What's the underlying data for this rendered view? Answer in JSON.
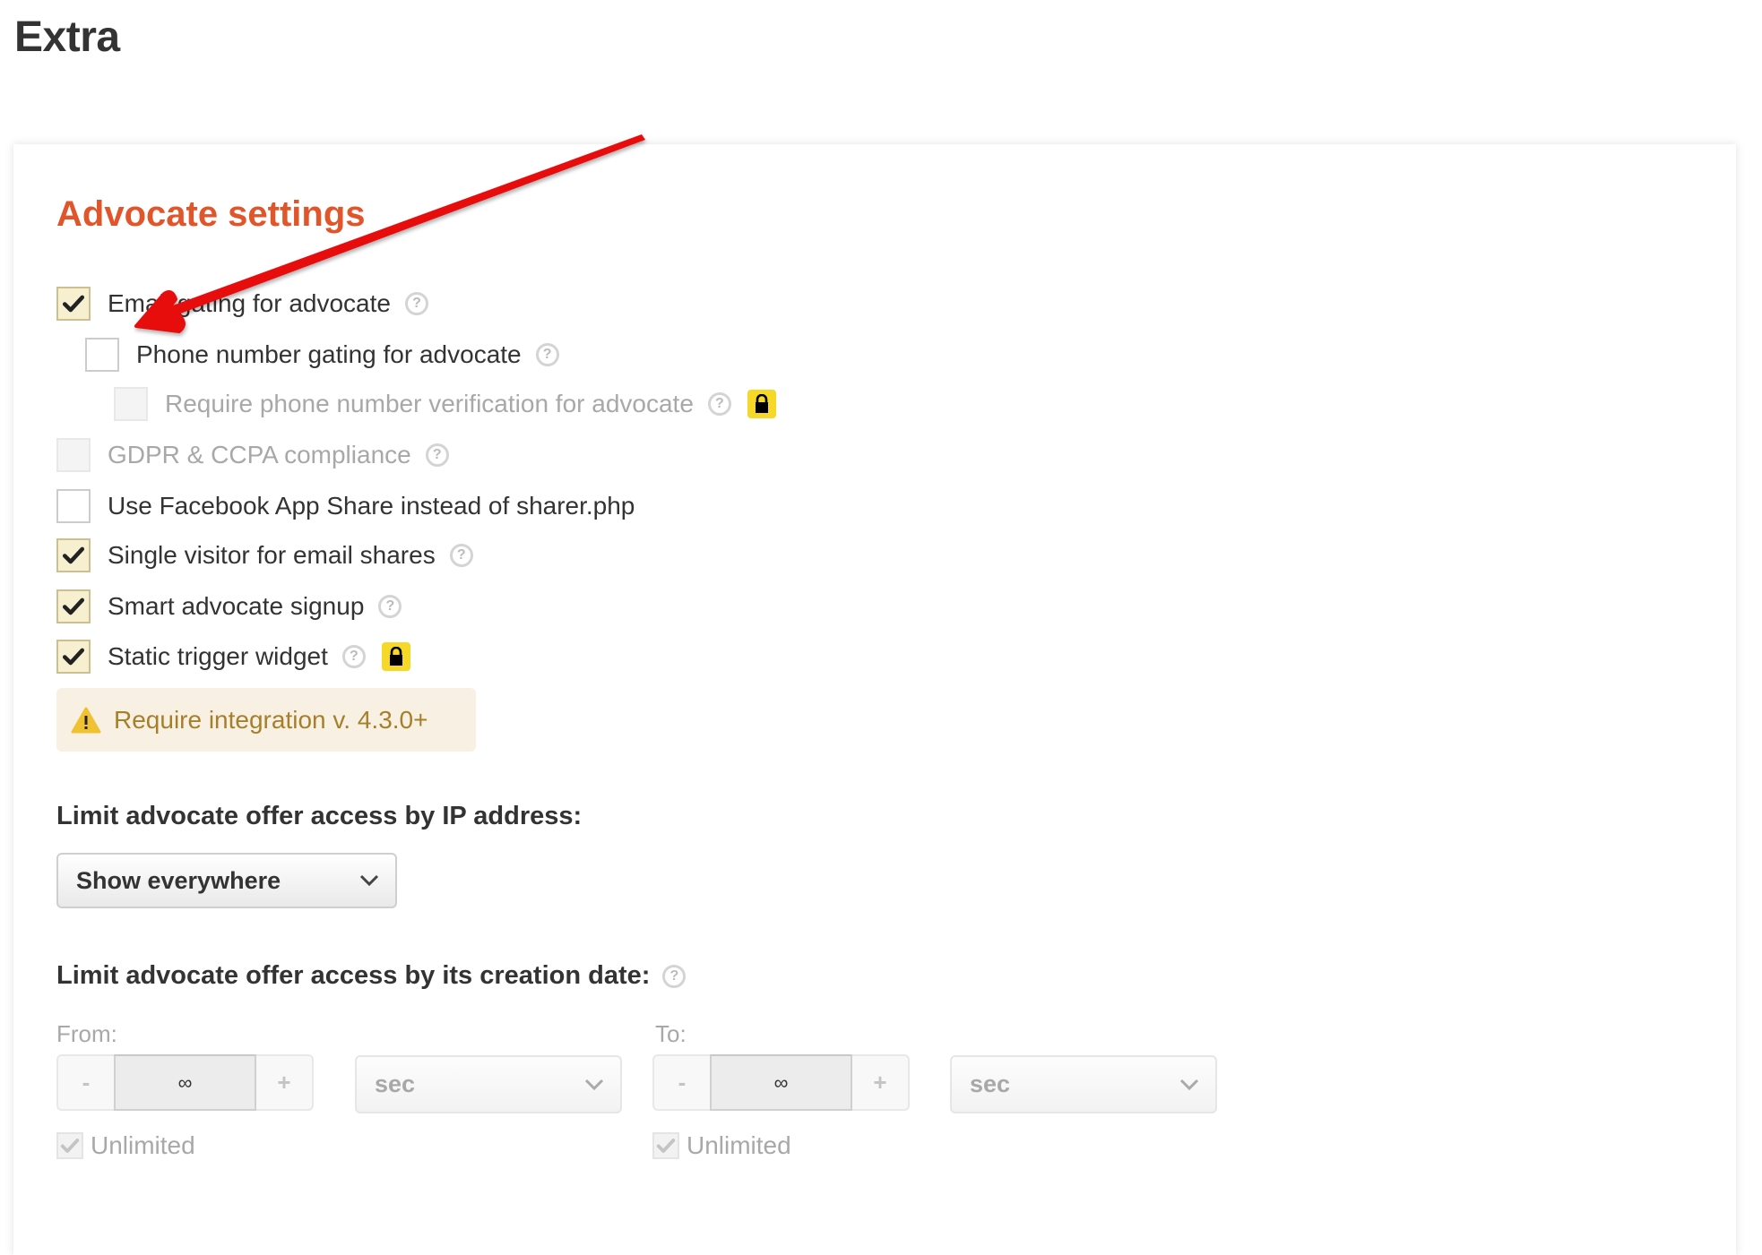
{
  "page": {
    "title": "Extra"
  },
  "section": {
    "title": "Advocate settings",
    "options": [
      {
        "label": "Email gating for advocate",
        "checked": true,
        "disabled": false,
        "help": true,
        "locked": false
      },
      {
        "label": "Phone number gating for advocate",
        "checked": false,
        "disabled": false,
        "help": true,
        "locked": false
      },
      {
        "label": "Require phone number verification for advocate",
        "checked": false,
        "disabled": true,
        "help": true,
        "locked": true
      },
      {
        "label": "GDPR & CCPA compliance",
        "checked": false,
        "disabled": true,
        "help": true,
        "locked": false
      },
      {
        "label": "Use Facebook App Share instead of sharer.php",
        "checked": false,
        "disabled": false,
        "help": false,
        "locked": false
      },
      {
        "label": "Single visitor for email shares",
        "checked": true,
        "disabled": false,
        "help": true,
        "locked": false
      },
      {
        "label": "Smart advocate signup",
        "checked": true,
        "disabled": false,
        "help": true,
        "locked": false
      },
      {
        "label": "Static trigger widget",
        "checked": true,
        "disabled": false,
        "help": true,
        "locked": true
      }
    ],
    "alert": {
      "icon": "warning-icon",
      "text": "Require integration v. 4.3.0+"
    }
  },
  "ip_limit": {
    "heading": "Limit advocate offer access by IP address:",
    "selected": "Show everywhere"
  },
  "date_limit": {
    "heading": "Limit advocate offer access by its creation date:",
    "from": {
      "label": "From:",
      "minus": "-",
      "value": "∞",
      "plus": "+",
      "unit": "sec",
      "unlimited_label": "Unlimited",
      "unlimited_checked": true
    },
    "to": {
      "label": "To:",
      "minus": "-",
      "value": "∞",
      "plus": "+",
      "unit": "sec",
      "unlimited_label": "Unlimited",
      "unlimited_checked": true
    }
  },
  "icons": {
    "help": "?",
    "lock": "lock-icon",
    "check": "checkmark-icon",
    "chevron": "chevron-down-icon"
  },
  "colors": {
    "accent": "#e0552a",
    "lock_badge": "#f5d828",
    "alert_bg": "#f8f1e3",
    "alert_text": "#a67f2b",
    "annotation_arrow": "#e8080a"
  }
}
